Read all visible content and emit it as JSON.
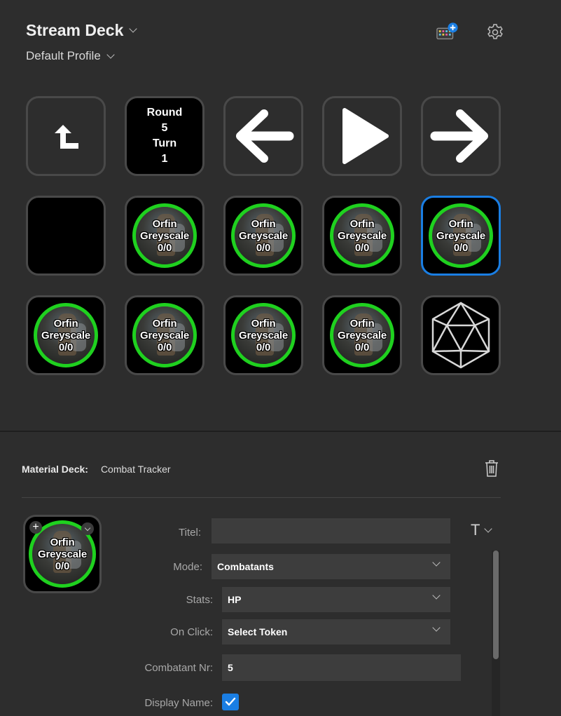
{
  "header": {
    "app_title": "Stream Deck",
    "profile": "Default Profile",
    "store_icon": "store-plus-icon",
    "settings_icon": "gear-icon"
  },
  "keys": {
    "back": {
      "icon": "back-arrow-icon"
    },
    "round": {
      "line1": "Round",
      "line2": "5",
      "line3": "Turn",
      "line4": "1"
    },
    "prev": {
      "icon": "arrow-left-icon"
    },
    "play": {
      "icon": "play-icon"
    },
    "next": {
      "icon": "arrow-right-icon"
    },
    "token": {
      "name1": "Orfin",
      "name2": "Greyscale",
      "hp": "0/0"
    },
    "dice": {
      "icon": "d20-icon"
    }
  },
  "inspector": {
    "plugin": "Material Deck:",
    "action": "Combat Tracker",
    "titel_label": "Titel:",
    "titel_value": "",
    "mode_label": "Mode:",
    "mode_value": "Combatants",
    "stats_label": "Stats:",
    "stats_value": "HP",
    "onclick_label": "On Click:",
    "onclick_value": "Select Token",
    "combatant_label": "Combatant Nr:",
    "combatant_value": "5",
    "display_name_label": "Display Name:",
    "display_name_checked": true,
    "plus": "+"
  },
  "colors": {
    "accent": "#1a7ee3",
    "token_ring": "#1fd11f"
  }
}
